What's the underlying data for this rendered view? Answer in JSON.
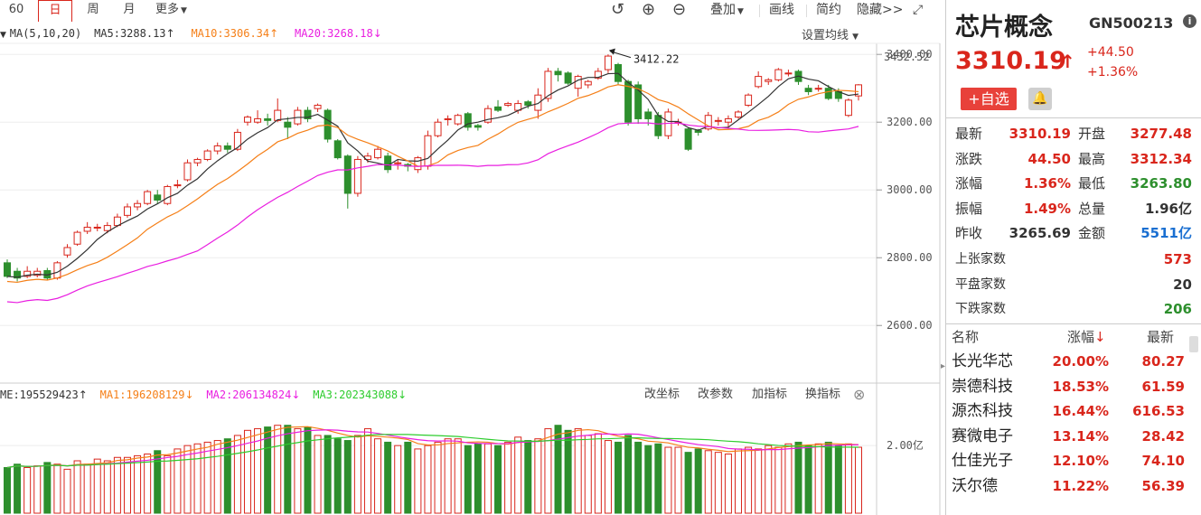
{
  "toolbar": {
    "periods": [
      {
        "label": "60",
        "active": false
      },
      {
        "label": "日",
        "active": true
      },
      {
        "label": "周",
        "active": false
      },
      {
        "label": "月",
        "active": false
      }
    ],
    "more": "更多",
    "overlay": "叠加",
    "draw": "画线",
    "simple": "简约",
    "hide": "隐藏>>"
  },
  "legend": {
    "ma_label": "MA(5,10,20)",
    "ma5": "MA5:3288.13",
    "ma10": "MA10:3306.34",
    "ma20": "MA20:3268.18",
    "settings": "设置均线"
  },
  "volume_legend": {
    "vol": "ME:195529423",
    "ma1": "MA1:196208129",
    "ma2": "MA2:206134824",
    "ma3": "MA3:202343088",
    "btn1": "改坐标",
    "btn2": "改参数",
    "btn3": "加指标",
    "btn4": "换指标"
  },
  "colors": {
    "up": "#d9261c",
    "down": "#2d8f2d",
    "ma5": "#333333",
    "ma10": "#f57f17",
    "ma20": "#e91ee0",
    "vma2": "#e91ee0",
    "vma3": "#2ecc2e"
  },
  "chart_data": {
    "type": "candlestick",
    "price_axis": {
      "ticks": [
        "3400.00",
        "3200.00",
        "3000.00",
        "2800.00",
        "2600.00"
      ],
      "tick_values": [
        3400,
        3200,
        3000,
        2800,
        2600
      ],
      "top_label": "3432.52",
      "ylim": [
        2430,
        3432.52
      ]
    },
    "volume_axis": {
      "ticks": [
        "2.00亿"
      ],
      "tick_values": [
        2.0
      ],
      "unit": "亿",
      "ylim": [
        0,
        3.1
      ]
    },
    "max_annotation": {
      "value": "3412.22"
    },
    "candles": [
      [
        2785,
        2745,
        2795,
        2740
      ],
      [
        2760,
        2740,
        2770,
        2730
      ],
      [
        2745,
        2760,
        2775,
        2740
      ],
      [
        2748,
        2760,
        2770,
        2742
      ],
      [
        2762,
        2740,
        2770,
        2735
      ],
      [
        2740,
        2785,
        2790,
        2735
      ],
      [
        2808,
        2830,
        2840,
        2800
      ],
      [
        2840,
        2875,
        2880,
        2835
      ],
      [
        2878,
        2890,
        2905,
        2870
      ],
      [
        2890,
        2890,
        2900,
        2878
      ],
      [
        2880,
        2895,
        2905,
        2872
      ],
      [
        2895,
        2920,
        2930,
        2890
      ],
      [
        2925,
        2950,
        2960,
        2918
      ],
      [
        2950,
        2960,
        2970,
        2940
      ],
      [
        2960,
        2995,
        3000,
        2955
      ],
      [
        2985,
        2970,
        3000,
        2960
      ],
      [
        2960,
        3010,
        3015,
        2955
      ],
      [
        3015,
        3015,
        3030,
        3005
      ],
      [
        3030,
        3080,
        3090,
        3025
      ],
      [
        3080,
        3090,
        3095,
        3070
      ],
      [
        3090,
        3115,
        3120,
        3085
      ],
      [
        3115,
        3130,
        3140,
        3105
      ],
      [
        3130,
        3120,
        3140,
        3110
      ],
      [
        3120,
        3170,
        3180,
        3115
      ],
      [
        3200,
        3215,
        3220,
        3190
      ],
      [
        3200,
        3210,
        3235,
        3195
      ],
      [
        3210,
        3205,
        3225,
        3190
      ],
      [
        3205,
        3235,
        3270,
        3200
      ],
      [
        3200,
        3185,
        3215,
        3150
      ],
      [
        3195,
        3235,
        3245,
        3190
      ],
      [
        3235,
        3210,
        3245,
        3200
      ],
      [
        3240,
        3250,
        3255,
        3230
      ],
      [
        3235,
        3150,
        3240,
        3140
      ],
      [
        3145,
        3095,
        3150,
        3090
      ],
      [
        3100,
        2990,
        3105,
        2945
      ],
      [
        2990,
        3090,
        3100,
        2980
      ],
      [
        3090,
        3100,
        3110,
        3080
      ],
      [
        3095,
        3120,
        3130,
        3090
      ],
      [
        3100,
        3060,
        3110,
        3050
      ],
      [
        3080,
        3080,
        3090,
        3060
      ],
      [
        3075,
        3070,
        3080,
        3055
      ],
      [
        3060,
        3095,
        3100,
        3050
      ],
      [
        3070,
        3160,
        3175,
        3060
      ],
      [
        3160,
        3200,
        3210,
        3155
      ],
      [
        3210,
        3210,
        3220,
        3190
      ],
      [
        3195,
        3220,
        3225,
        3190
      ],
      [
        3225,
        3185,
        3230,
        3175
      ],
      [
        3190,
        3185,
        3195,
        3175
      ],
      [
        3200,
        3240,
        3250,
        3195
      ],
      [
        3245,
        3235,
        3265,
        3230
      ],
      [
        3250,
        3255,
        3260,
        3245
      ],
      [
        3235,
        3255,
        3265,
        3225
      ],
      [
        3260,
        3250,
        3265,
        3240
      ],
      [
        3235,
        3280,
        3300,
        3210
      ],
      [
        3270,
        3350,
        3360,
        3260
      ],
      [
        3350,
        3340,
        3360,
        3320
      ],
      [
        3345,
        3315,
        3350,
        3310
      ],
      [
        3300,
        3335,
        3340,
        3275
      ],
      [
        3310,
        3320,
        3325,
        3300
      ],
      [
        3330,
        3350,
        3360,
        3325
      ],
      [
        3355,
        3395,
        3400,
        3345
      ],
      [
        3370,
        3320,
        3375,
        3310
      ],
      [
        3320,
        3200,
        3325,
        3190
      ],
      [
        3310,
        3210,
        3320,
        3195
      ],
      [
        3230,
        3210,
        3240,
        3190
      ],
      [
        3220,
        3160,
        3230,
        3150
      ],
      [
        3160,
        3230,
        3240,
        3150
      ],
      [
        3200,
        3200,
        3210,
        3190
      ],
      [
        3180,
        3120,
        3185,
        3115
      ],
      [
        3175,
        3170,
        3180,
        3160
      ],
      [
        3180,
        3220,
        3230,
        3175
      ],
      [
        3205,
        3205,
        3215,
        3190
      ],
      [
        3200,
        3210,
        3220,
        3180
      ],
      [
        3215,
        3230,
        3235,
        3210
      ],
      [
        3250,
        3280,
        3285,
        3245
      ],
      [
        3305,
        3335,
        3350,
        3300
      ],
      [
        3320,
        3325,
        3330,
        3310
      ],
      [
        3325,
        3355,
        3360,
        3320
      ],
      [
        3345,
        3345,
        3355,
        3335
      ],
      [
        3350,
        3320,
        3355,
        3310
      ],
      [
        3300,
        3290,
        3310,
        3280
      ],
      [
        3300,
        3300,
        3310,
        3290
      ],
      [
        3300,
        3270,
        3310,
        3265
      ],
      [
        3290,
        3270,
        3300,
        3260
      ],
      [
        3220,
        3265,
        3270,
        3215
      ],
      [
        3277.48,
        3310.19,
        3312.34,
        3263.8
      ]
    ],
    "volumes": [
      1.35,
      1.45,
      1.35,
      1.4,
      1.5,
      1.45,
      1.3,
      1.55,
      1.45,
      1.6,
      1.55,
      1.65,
      1.65,
      1.7,
      1.75,
      1.85,
      1.7,
      1.9,
      2.0,
      2.05,
      2.1,
      2.15,
      2.2,
      2.3,
      2.45,
      2.5,
      2.55,
      2.6,
      2.6,
      2.5,
      2.55,
      2.3,
      2.3,
      2.2,
      2.15,
      2.3,
      2.5,
      2.2,
      2.1,
      2.0,
      2.1,
      1.9,
      2.0,
      2.1,
      2.2,
      2.2,
      2.0,
      2.05,
      2.05,
      2.0,
      2.1,
      2.25,
      2.15,
      2.2,
      2.5,
      2.6,
      2.45,
      2.5,
      2.3,
      2.35,
      2.15,
      2.1,
      2.3,
      2.1,
      2.0,
      2.05,
      1.95,
      1.95,
      1.8,
      1.9,
      1.85,
      1.8,
      1.75,
      1.9,
      1.95,
      1.9,
      2.0,
      1.95,
      2.05,
      2.1,
      2.0,
      2.05,
      2.1,
      2.0,
      2.05,
      1.95
    ]
  },
  "quote": {
    "name": "芯片概念",
    "code": "GN500213",
    "price": "3310.19",
    "change": "+44.50",
    "change_pct": "+1.36%",
    "add_watch": "+自选",
    "rows": [
      {
        "k1": "最新",
        "v1": "3310.19",
        "c1": "red",
        "k2": "开盘",
        "v2": "3277.48",
        "c2": "red"
      },
      {
        "k1": "涨跌",
        "v1": "44.50",
        "c1": "red",
        "k2": "最高",
        "v2": "3312.34",
        "c2": "red"
      },
      {
        "k1": "涨幅",
        "v1": "1.36%",
        "c1": "red",
        "k2": "最低",
        "v2": "3263.80",
        "c2": "green"
      },
      {
        "k1": "振幅",
        "v1": "1.49%",
        "c1": "red",
        "k2": "总量",
        "v2": "1.96亿",
        "c2": "dark"
      },
      {
        "k1": "昨收",
        "v1": "3265.69",
        "c1": "dark",
        "k2": "金额",
        "v2": "5511亿",
        "c2": "blue"
      }
    ],
    "counts": [
      {
        "k": "上张家数",
        "v": "573",
        "c": "red"
      },
      {
        "k": "平盘家数",
        "v": "20",
        "c": "dark"
      },
      {
        "k": "下跌家数",
        "v": "206",
        "c": "green"
      }
    ],
    "list_header": {
      "name": "名称",
      "pct": "涨幅",
      "last": "最新"
    },
    "list": [
      {
        "name": "长光华芯",
        "pct": "20.00%",
        "last": "80.27"
      },
      {
        "name": "崇德科技",
        "pct": "18.53%",
        "last": "61.59"
      },
      {
        "name": "源杰科技",
        "pct": "16.44%",
        "last": "616.53"
      },
      {
        "name": "赛微电子",
        "pct": "13.14%",
        "last": "28.42"
      },
      {
        "name": "仕佳光子",
        "pct": "12.10%",
        "last": "74.10"
      },
      {
        "name": "沃尔德",
        "pct": "11.22%",
        "last": "56.39"
      }
    ]
  }
}
